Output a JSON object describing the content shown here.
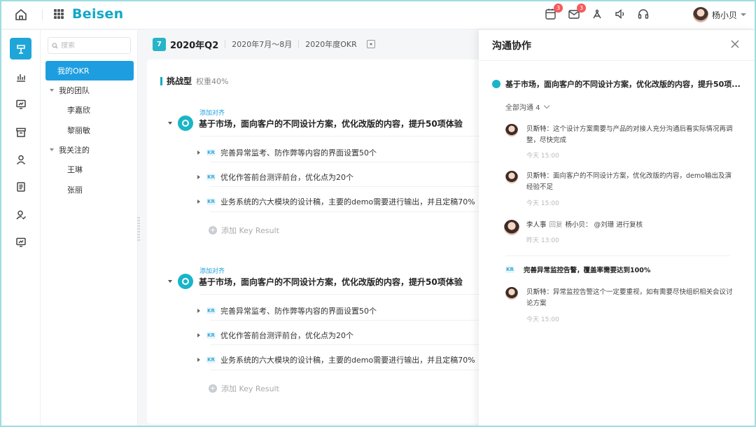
{
  "topbar": {
    "brand": "Beisen",
    "badges": {
      "calendar": "3",
      "mail": "3"
    },
    "user_name": "杨小贝"
  },
  "sidebar_tree": {
    "search_placeholder": "搜索",
    "items": [
      {
        "label": "我的OKR"
      },
      {
        "label": "我的团队"
      },
      {
        "label": "李嘉欣"
      },
      {
        "label": "黎丽敏"
      },
      {
        "label": "我关注的"
      },
      {
        "label": "王琳"
      },
      {
        "label": "张丽"
      }
    ]
  },
  "period": {
    "title": "2020年Q2",
    "range": "2020年7月～8月",
    "okr_label": "2020年度OKR"
  },
  "section": {
    "title": "挑战型",
    "weight": "权重40%"
  },
  "objectives": [
    {
      "align_link": "添加对齐",
      "title": "基于市场，面向客户的不同设计方案，优化改版的内容，提升50项体验",
      "krs": [
        {
          "tag": "KR",
          "text": "完善异常监考、防作弊等内容的界面设置50个"
        },
        {
          "tag": "KR",
          "text": "优化作答前台测评前台，优化点为20个"
        },
        {
          "tag": "KR",
          "text": "业务系统的六大模块的设计稿，主要的demo需要进行输出，并且定稿70%"
        }
      ],
      "add_kr": "添加 Key Result"
    },
    {
      "align_link": "添加对齐",
      "title": "基于市场，面向客户的不同设计方案，优化改版的内容，提升50项体验",
      "krs": [
        {
          "tag": "KR",
          "text": "完善异常监考、防作弊等内容的界面设置50个"
        },
        {
          "tag": "KR",
          "text": "优化作答前台测评前台，优化点为20个"
        },
        {
          "tag": "KR",
          "text": "业务系统的六大模块的设计稿，主要的demo需要进行输出，并且定稿70%"
        }
      ],
      "add_kr": "添加 Key Result"
    }
  ],
  "panel": {
    "title": "沟通协作",
    "objective": "基于市场，面向客户的不同设计方案，优化改版的内容，提升50项...",
    "filter": "全部沟通 4",
    "comments": [
      {
        "name": "贝斯特：",
        "text": "这个设计方案需要与产品的对接人充分沟通后看实际情况再调整，尽快完成",
        "time": "今天 15:00"
      },
      {
        "name": "贝斯特：",
        "text": "面向客户的不同设计方案，优化改版的内容，demo输出及演经验不足",
        "time": "今天 15:00"
      },
      {
        "name": "李人事",
        "reply": "回复",
        "target": "杨小贝：",
        "text": "@刘珊 进行复核",
        "time": "昨天 13:00"
      }
    ],
    "kr_tag": "KR",
    "kr_title": "完善异常监控告警，覆盖率需要达到100%",
    "kr_comment": {
      "name": "贝斯特：",
      "text": "异常监控告警这个一定要重视，如有需要尽快组织相关会议讨论方案",
      "time": "今天 15:00"
    }
  },
  "colors": {
    "brand": "#12a8c6",
    "active_nav": "#1e9ee0",
    "badge": "#f45b5b",
    "frame": "#9fdde0"
  },
  "icons": {
    "rail": [
      "flag-icon",
      "bar-chart-icon",
      "presentation-icon",
      "archive-icon",
      "user-icon",
      "document-icon",
      "user-check-icon",
      "monitor-icon"
    ],
    "topbar": [
      "home-icon",
      "apps-grid-icon",
      "calendar-icon",
      "mail-icon",
      "share-icon",
      "speaker-icon",
      "headset-icon"
    ]
  }
}
